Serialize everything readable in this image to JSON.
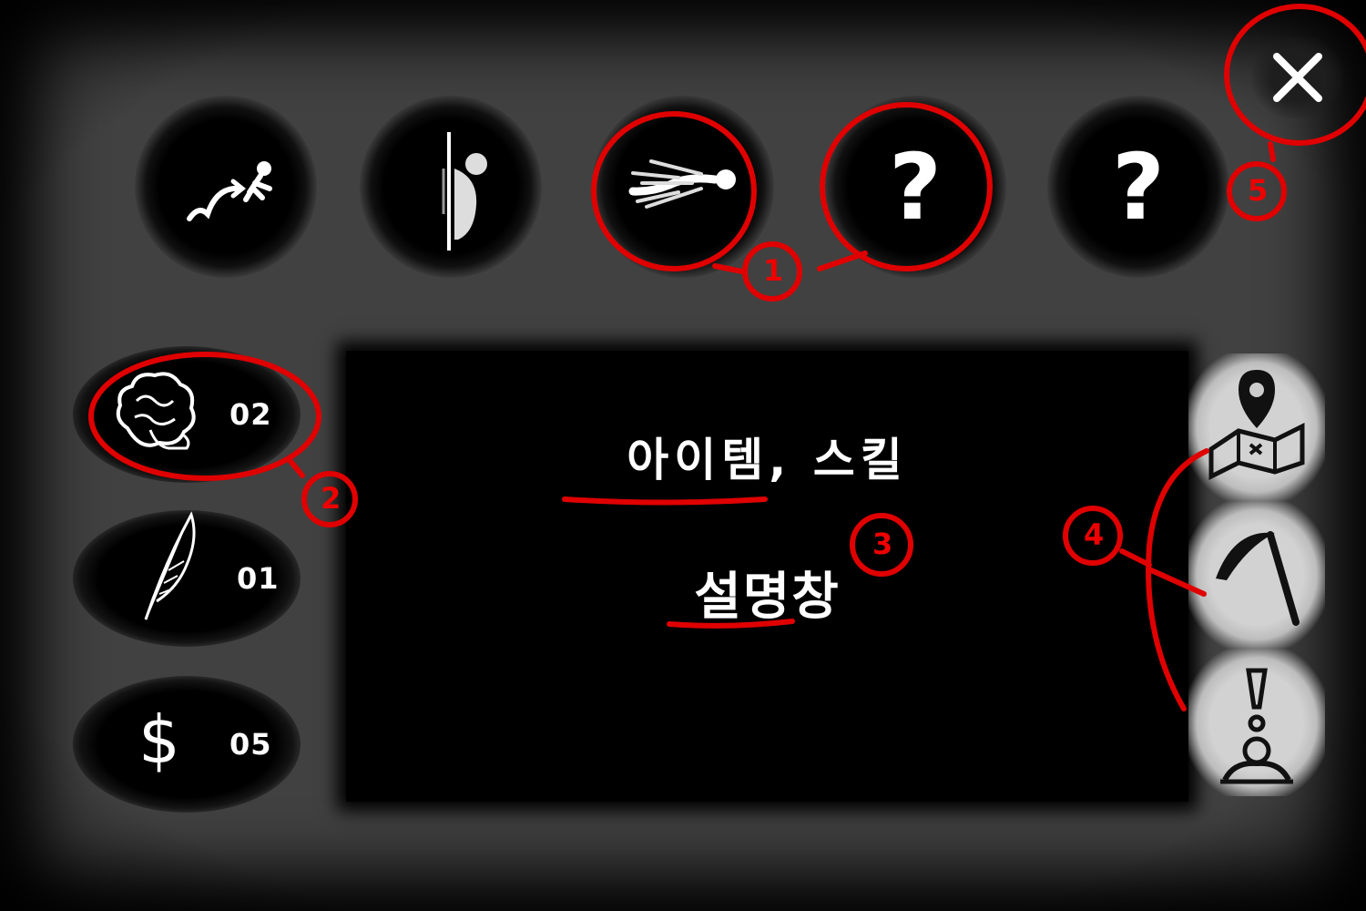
{
  "skills": [
    {
      "icon": "leap-figure-icon"
    },
    {
      "icon": "wall-hide-figure-icon"
    },
    {
      "icon": "dash-figure-icon"
    },
    {
      "icon": "question-mark-icon",
      "label": "?"
    },
    {
      "icon": "question-mark-icon",
      "label": "?"
    }
  ],
  "items": [
    {
      "icon": "brain-icon",
      "count": "02"
    },
    {
      "icon": "feather-icon",
      "count": "01"
    },
    {
      "icon": "dollar-icon",
      "symbol": "$",
      "count": "05"
    }
  ],
  "description": {
    "title": "아이템, 스킬",
    "subtitle": "설명창"
  },
  "tools": [
    {
      "icon": "map-pin-icon"
    },
    {
      "icon": "scythe-icon"
    },
    {
      "icon": "alert-figure-icon"
    }
  ],
  "close": {
    "icon": "close-icon"
  },
  "annotations": {
    "color": "#e00000",
    "labels": [
      "1",
      "2",
      "3",
      "4",
      "5"
    ]
  }
}
